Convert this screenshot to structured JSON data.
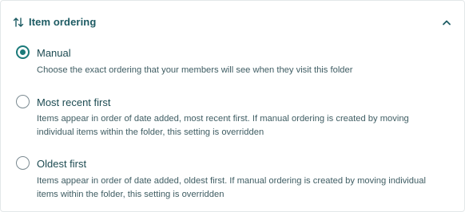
{
  "section": {
    "title": "Item ordering",
    "expanded": true,
    "accent_color": "#1b7a7a",
    "header_icon": "sort-arrows-icon",
    "toggle_icon": "chevron-up-icon"
  },
  "options": [
    {
      "label": "Manual",
      "description": "Choose the exact ordering that your members will see when they visit this folder",
      "selected": true
    },
    {
      "label": "Most recent first",
      "description_line1": "Items appear in order of date added, most recent first. If manual ordering is created by moving",
      "description_line2": "individual items within the folder, this setting is overridden",
      "selected": false
    },
    {
      "label": "Oldest first",
      "description_line1": "Items appear in order of date added, oldest first. If manual ordering is created by moving individual",
      "description_line2": "items within the folder, this setting is overridden",
      "selected": false
    }
  ]
}
